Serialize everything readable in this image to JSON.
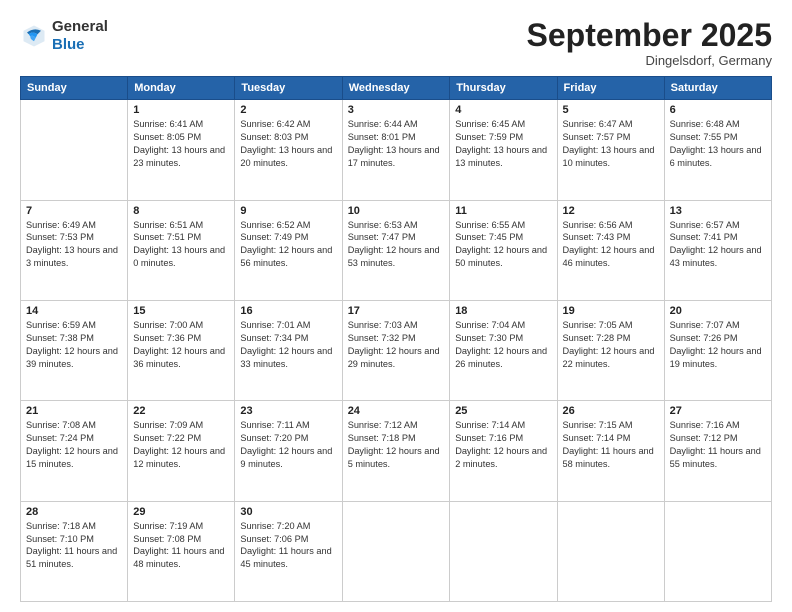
{
  "logo": {
    "general": "General",
    "blue": "Blue"
  },
  "header": {
    "month": "September 2025",
    "location": "Dingelsdorf, Germany"
  },
  "days_of_week": [
    "Sunday",
    "Monday",
    "Tuesday",
    "Wednesday",
    "Thursday",
    "Friday",
    "Saturday"
  ],
  "weeks": [
    [
      {
        "day": "",
        "sunrise": "",
        "sunset": "",
        "daylight": ""
      },
      {
        "day": "1",
        "sunrise": "Sunrise: 6:41 AM",
        "sunset": "Sunset: 8:05 PM",
        "daylight": "Daylight: 13 hours and 23 minutes."
      },
      {
        "day": "2",
        "sunrise": "Sunrise: 6:42 AM",
        "sunset": "Sunset: 8:03 PM",
        "daylight": "Daylight: 13 hours and 20 minutes."
      },
      {
        "day": "3",
        "sunrise": "Sunrise: 6:44 AM",
        "sunset": "Sunset: 8:01 PM",
        "daylight": "Daylight: 13 hours and 17 minutes."
      },
      {
        "day": "4",
        "sunrise": "Sunrise: 6:45 AM",
        "sunset": "Sunset: 7:59 PM",
        "daylight": "Daylight: 13 hours and 13 minutes."
      },
      {
        "day": "5",
        "sunrise": "Sunrise: 6:47 AM",
        "sunset": "Sunset: 7:57 PM",
        "daylight": "Daylight: 13 hours and 10 minutes."
      },
      {
        "day": "6",
        "sunrise": "Sunrise: 6:48 AM",
        "sunset": "Sunset: 7:55 PM",
        "daylight": "Daylight: 13 hours and 6 minutes."
      }
    ],
    [
      {
        "day": "7",
        "sunrise": "Sunrise: 6:49 AM",
        "sunset": "Sunset: 7:53 PM",
        "daylight": "Daylight: 13 hours and 3 minutes."
      },
      {
        "day": "8",
        "sunrise": "Sunrise: 6:51 AM",
        "sunset": "Sunset: 7:51 PM",
        "daylight": "Daylight: 13 hours and 0 minutes."
      },
      {
        "day": "9",
        "sunrise": "Sunrise: 6:52 AM",
        "sunset": "Sunset: 7:49 PM",
        "daylight": "Daylight: 12 hours and 56 minutes."
      },
      {
        "day": "10",
        "sunrise": "Sunrise: 6:53 AM",
        "sunset": "Sunset: 7:47 PM",
        "daylight": "Daylight: 12 hours and 53 minutes."
      },
      {
        "day": "11",
        "sunrise": "Sunrise: 6:55 AM",
        "sunset": "Sunset: 7:45 PM",
        "daylight": "Daylight: 12 hours and 50 minutes."
      },
      {
        "day": "12",
        "sunrise": "Sunrise: 6:56 AM",
        "sunset": "Sunset: 7:43 PM",
        "daylight": "Daylight: 12 hours and 46 minutes."
      },
      {
        "day": "13",
        "sunrise": "Sunrise: 6:57 AM",
        "sunset": "Sunset: 7:41 PM",
        "daylight": "Daylight: 12 hours and 43 minutes."
      }
    ],
    [
      {
        "day": "14",
        "sunrise": "Sunrise: 6:59 AM",
        "sunset": "Sunset: 7:38 PM",
        "daylight": "Daylight: 12 hours and 39 minutes."
      },
      {
        "day": "15",
        "sunrise": "Sunrise: 7:00 AM",
        "sunset": "Sunset: 7:36 PM",
        "daylight": "Daylight: 12 hours and 36 minutes."
      },
      {
        "day": "16",
        "sunrise": "Sunrise: 7:01 AM",
        "sunset": "Sunset: 7:34 PM",
        "daylight": "Daylight: 12 hours and 33 minutes."
      },
      {
        "day": "17",
        "sunrise": "Sunrise: 7:03 AM",
        "sunset": "Sunset: 7:32 PM",
        "daylight": "Daylight: 12 hours and 29 minutes."
      },
      {
        "day": "18",
        "sunrise": "Sunrise: 7:04 AM",
        "sunset": "Sunset: 7:30 PM",
        "daylight": "Daylight: 12 hours and 26 minutes."
      },
      {
        "day": "19",
        "sunrise": "Sunrise: 7:05 AM",
        "sunset": "Sunset: 7:28 PM",
        "daylight": "Daylight: 12 hours and 22 minutes."
      },
      {
        "day": "20",
        "sunrise": "Sunrise: 7:07 AM",
        "sunset": "Sunset: 7:26 PM",
        "daylight": "Daylight: 12 hours and 19 minutes."
      }
    ],
    [
      {
        "day": "21",
        "sunrise": "Sunrise: 7:08 AM",
        "sunset": "Sunset: 7:24 PM",
        "daylight": "Daylight: 12 hours and 15 minutes."
      },
      {
        "day": "22",
        "sunrise": "Sunrise: 7:09 AM",
        "sunset": "Sunset: 7:22 PM",
        "daylight": "Daylight: 12 hours and 12 minutes."
      },
      {
        "day": "23",
        "sunrise": "Sunrise: 7:11 AM",
        "sunset": "Sunset: 7:20 PM",
        "daylight": "Daylight: 12 hours and 9 minutes."
      },
      {
        "day": "24",
        "sunrise": "Sunrise: 7:12 AM",
        "sunset": "Sunset: 7:18 PM",
        "daylight": "Daylight: 12 hours and 5 minutes."
      },
      {
        "day": "25",
        "sunrise": "Sunrise: 7:14 AM",
        "sunset": "Sunset: 7:16 PM",
        "daylight": "Daylight: 12 hours and 2 minutes."
      },
      {
        "day": "26",
        "sunrise": "Sunrise: 7:15 AM",
        "sunset": "Sunset: 7:14 PM",
        "daylight": "Daylight: 11 hours and 58 minutes."
      },
      {
        "day": "27",
        "sunrise": "Sunrise: 7:16 AM",
        "sunset": "Sunset: 7:12 PM",
        "daylight": "Daylight: 11 hours and 55 minutes."
      }
    ],
    [
      {
        "day": "28",
        "sunrise": "Sunrise: 7:18 AM",
        "sunset": "Sunset: 7:10 PM",
        "daylight": "Daylight: 11 hours and 51 minutes."
      },
      {
        "day": "29",
        "sunrise": "Sunrise: 7:19 AM",
        "sunset": "Sunset: 7:08 PM",
        "daylight": "Daylight: 11 hours and 48 minutes."
      },
      {
        "day": "30",
        "sunrise": "Sunrise: 7:20 AM",
        "sunset": "Sunset: 7:06 PM",
        "daylight": "Daylight: 11 hours and 45 minutes."
      },
      {
        "day": "",
        "sunrise": "",
        "sunset": "",
        "daylight": ""
      },
      {
        "day": "",
        "sunrise": "",
        "sunset": "",
        "daylight": ""
      },
      {
        "day": "",
        "sunrise": "",
        "sunset": "",
        "daylight": ""
      },
      {
        "day": "",
        "sunrise": "",
        "sunset": "",
        "daylight": ""
      }
    ]
  ]
}
